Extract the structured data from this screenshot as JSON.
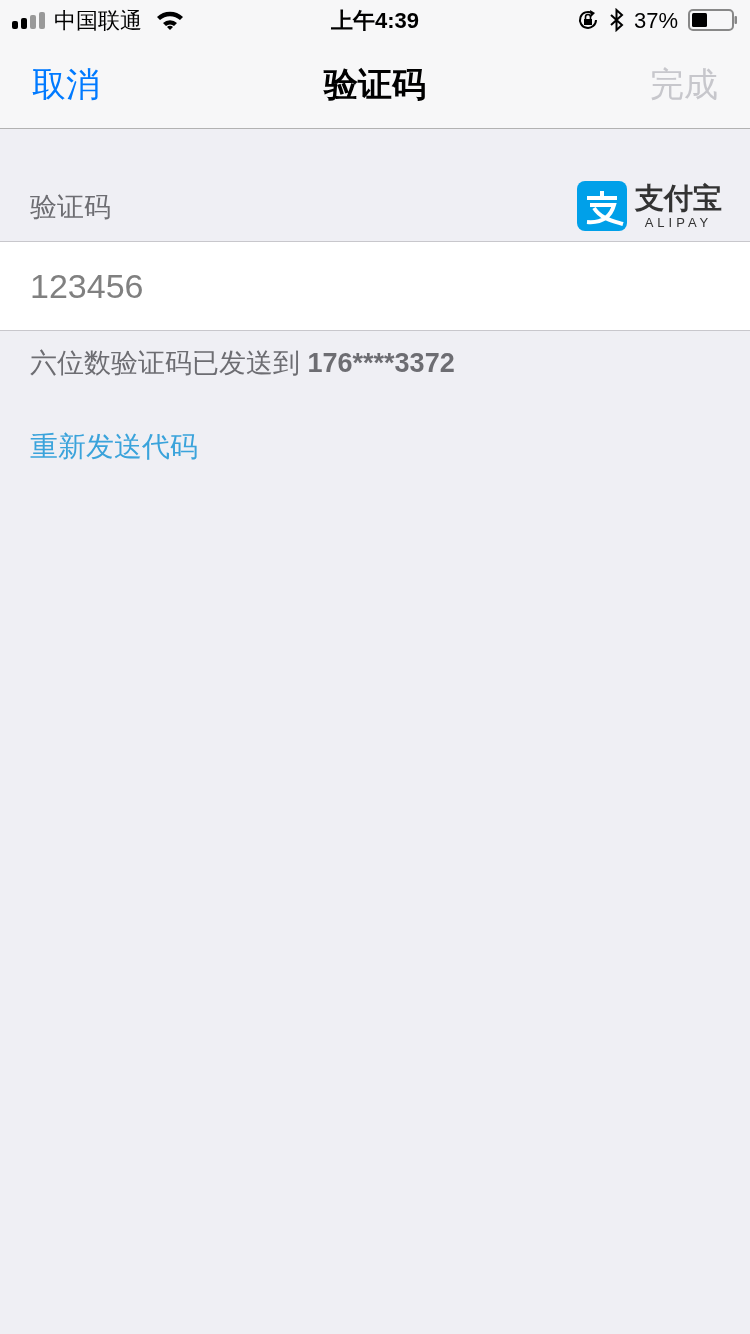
{
  "status_bar": {
    "carrier": "中国联通",
    "time": "上午4:39",
    "battery": "37%"
  },
  "nav_bar": {
    "left_button": "取消",
    "title": "验证码",
    "right_button": {
      "label": "完成",
      "disabled": true
    }
  },
  "section": {
    "header": "验证码",
    "logo": {
      "name": "支付宝",
      "subtitle": "ALIPAY"
    }
  },
  "code_field": {
    "placeholder": "123456"
  },
  "hint": {
    "text": "六位数验证码已发送到",
    "phone_number": "176****3372"
  },
  "resend_link": "重新发送代码"
}
